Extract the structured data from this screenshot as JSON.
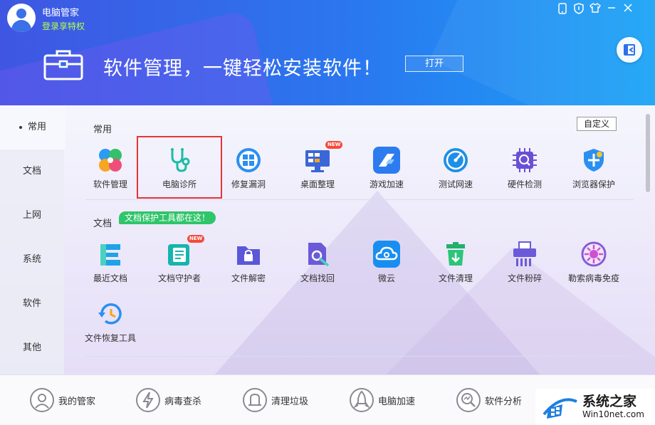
{
  "header": {
    "app_title": "电脑管家",
    "login_link": "登录享特权",
    "banner_text": "软件管理，一键轻松安装软件！",
    "open_button": "打开"
  },
  "sidebar": {
    "items": [
      {
        "label": "常用",
        "active": true
      },
      {
        "label": "文档"
      },
      {
        "label": "上网"
      },
      {
        "label": "系统"
      },
      {
        "label": "软件"
      },
      {
        "label": "其他"
      }
    ]
  },
  "content": {
    "custom_button": "自定义",
    "section_common": {
      "title": "常用",
      "tiles": [
        {
          "label": "软件管理",
          "icon": "clover-icon"
        },
        {
          "label": "电脑诊所",
          "icon": "stethoscope-icon"
        },
        {
          "label": "修复漏洞",
          "icon": "windows-shield-icon"
        },
        {
          "label": "桌面整理",
          "icon": "monitor-icon",
          "badge": "NEW"
        },
        {
          "label": "游戏加速",
          "icon": "game-boost-icon"
        },
        {
          "label": "测试网速",
          "icon": "speedometer-icon"
        },
        {
          "label": "硬件检测",
          "icon": "chip-icon"
        },
        {
          "label": "浏览器保护",
          "icon": "browser-shield-icon"
        }
      ]
    },
    "section_docs": {
      "title": "文档",
      "tag": "文档保护工具都在这！",
      "tiles": [
        {
          "label": "最近文档",
          "icon": "recent-docs-icon"
        },
        {
          "label": "文档守护者",
          "icon": "doc-guard-icon",
          "badge": "NEW"
        },
        {
          "label": "文件解密",
          "icon": "folder-lock-icon"
        },
        {
          "label": "文档找回",
          "icon": "doc-search-icon"
        },
        {
          "label": "微云",
          "icon": "cloud-icon"
        },
        {
          "label": "文件清理",
          "icon": "trash-icon"
        },
        {
          "label": "文件粉碎",
          "icon": "shredder-icon"
        },
        {
          "label": "勒索病毒免疫",
          "icon": "virus-immune-icon"
        },
        {
          "label": "文件恢复工具",
          "icon": "file-restore-icon"
        }
      ]
    }
  },
  "footer": {
    "items": [
      {
        "label": "我的管家",
        "icon": "butler-icon"
      },
      {
        "label": "病毒查杀",
        "icon": "virus-scan-icon"
      },
      {
        "label": "清理垃圾",
        "icon": "vacuum-icon"
      },
      {
        "label": "电脑加速",
        "icon": "rocket-icon"
      },
      {
        "label": "软件分析",
        "icon": "analysis-icon"
      }
    ]
  },
  "watermark": {
    "title": "系统之家",
    "url": "Win10net.com"
  },
  "colors": {
    "accent": "#2a78ef",
    "selection_outline": "#e53535",
    "tag_green": "#2fc56a",
    "badge_red": "#f44b3b"
  }
}
